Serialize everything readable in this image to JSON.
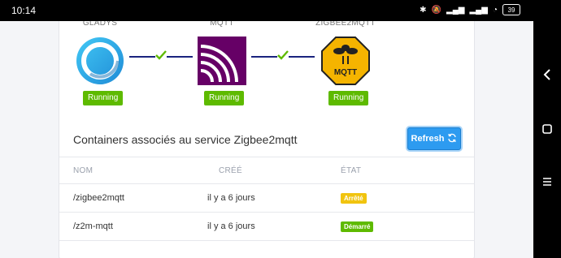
{
  "statusbar": {
    "time": "10:14",
    "battery": "39"
  },
  "services": [
    {
      "name": "GLADYS",
      "status": "Running",
      "icon": "gladys-logo-icon"
    },
    {
      "name": "MQTT",
      "status": "Running",
      "icon": "mqtt-logo-icon"
    },
    {
      "name": "ZIGBEE2MQTT",
      "status": "Running",
      "icon": "zigbee2mqtt-logo-icon"
    }
  ],
  "zigbee_logo_text": "MQTT",
  "section_title": "Containers associés au service Zigbee2mqtt",
  "refresh_label": "Refresh",
  "table": {
    "headers": [
      "NOM",
      "CRÉÉ",
      "ÉTAT"
    ],
    "rows": [
      {
        "name": "/zigbee2mqtt",
        "created": "il y a 6 jours",
        "state": "Arrêté",
        "state_color": "#f1c40f"
      },
      {
        "name": "/z2m-mqtt",
        "created": "il y a 6 jours",
        "state": "Démarré",
        "state_color": "#5eba00"
      }
    ]
  },
  "colors": {
    "running": "#5eba00",
    "connector": "#1a237e",
    "check": "#5eba00",
    "primary": "#2d9bf0"
  }
}
